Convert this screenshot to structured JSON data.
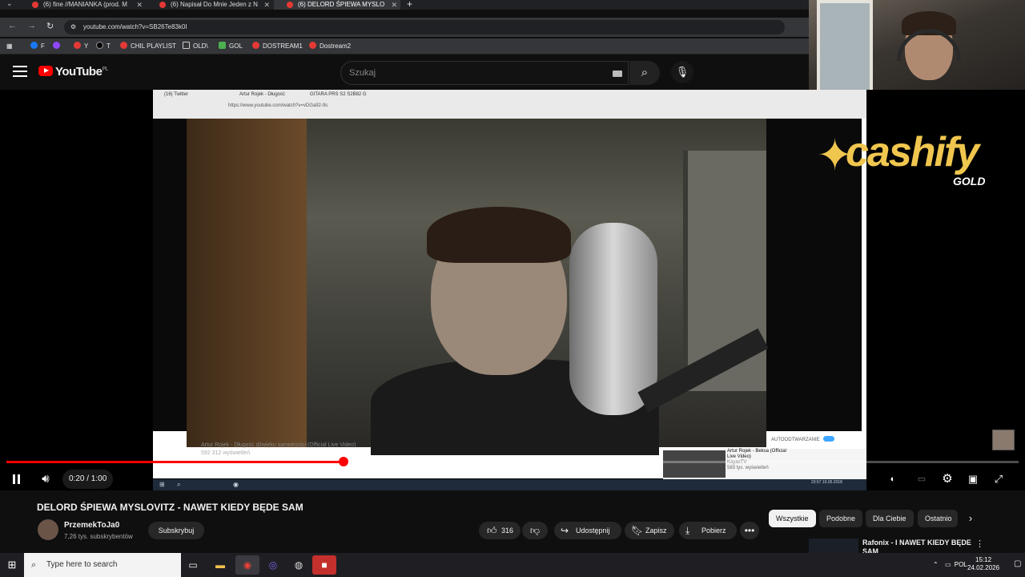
{
  "browser": {
    "tabs": [
      {
        "label": "(6) fine //MANIANKA (prod. M"
      },
      {
        "label": "(6) Napisał Do Mnie Jeden z N"
      },
      {
        "label": "(6) DELORD ŚPIEWA MYSLO"
      }
    ],
    "url": "youtube.com/watch?v=SB26Te83k0I",
    "bookmarks": [
      "F",
      "Y",
      "T",
      "CHIL PLAYLIST",
      "OLD\\",
      "GOL",
      "DOSTREAM1",
      "Dostream2"
    ]
  },
  "youtube": {
    "logo": "YouTube",
    "region": "PL",
    "search_placeholder": "Szukaj"
  },
  "player": {
    "time": "0:20 / 1:00",
    "progress": 0.333,
    "inner_tabs": [
      "(16) Twitter",
      "Artur Rojek - Długość",
      "GITARA PRS S2 S2B82 G"
    ],
    "inner_url": "https://www.youtube.com/watch?v=vDGa92-9s",
    "inner_video_title": "Artur Rojek - Długość dźwięku samotności (Official Live Video)",
    "inner_views": "592 312 wyświetleń",
    "inner_autoplay_label": "AUTOODTWARZANIE",
    "side_video_title": "Artur Rojek - Beksa (Official Live Video)",
    "side_video_channel": "KayaxTV",
    "side_video_views": "583 tys. wyświetleń",
    "inner_clock": "23:57\n19.05.2018",
    "overlay_brand": "cashify",
    "overlay_sub": "GOLD"
  },
  "video": {
    "title": "DELORD ŚPIEWA MYSLOVITZ - NAWET KIEDY BĘDE SAM",
    "channel": "PrzemekToJa0",
    "subscribers": "7,26 tys. subskrybentów",
    "subscribe_label": "Subskrybuj",
    "likes": "316",
    "share_label": "Udostępnij",
    "save_label": "Zapisz",
    "download_label": "Pobierz"
  },
  "chips": [
    "Wszystkie",
    "Podobne",
    "Dla Ciebie",
    "Ostatnio"
  ],
  "recommendation": {
    "title": "Rafonix - I NAWET KIEDY BĘDE SAM"
  },
  "taskbar": {
    "search_placeholder": "Type here to search",
    "language": "POL",
    "time": "15:12",
    "date": "24.02.2026"
  }
}
